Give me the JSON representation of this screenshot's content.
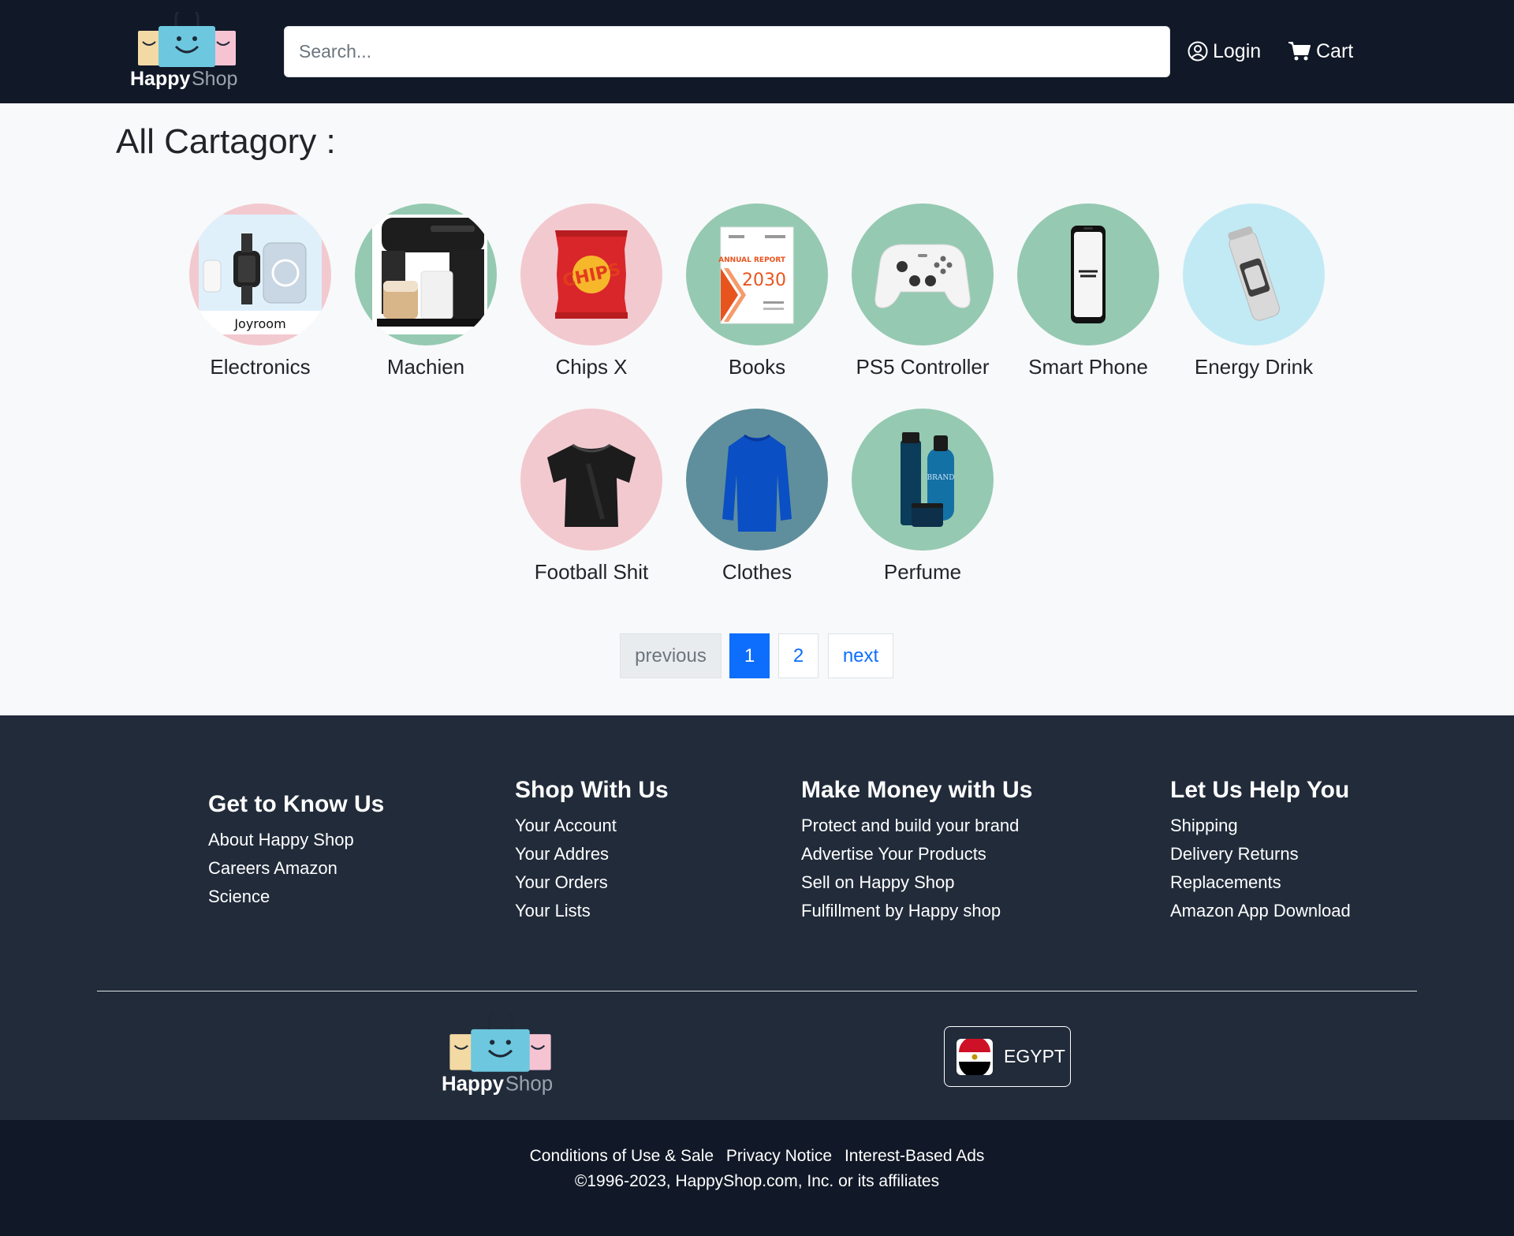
{
  "header": {
    "logo_text_happy": "Happy",
    "logo_text_shop": "Shop",
    "search_placeholder": "Search...",
    "login_label": "Login",
    "cart_label": "Cart"
  },
  "main": {
    "heading": "All Cartagory :",
    "categories": [
      {
        "label": "Electronics",
        "image_caption": "Joyroom"
      },
      {
        "label": "Machien"
      },
      {
        "label": "Chips X",
        "image_caption": "CHIPS"
      },
      {
        "label": "Books",
        "image_caption_1": "ANNUAL REPORT",
        "image_caption_2": "2030"
      },
      {
        "label": "PS5 Controller"
      },
      {
        "label": "Smart Phone"
      },
      {
        "label": "Energy Drink"
      },
      {
        "label": "Football Shit"
      },
      {
        "label": "Clothes"
      },
      {
        "label": "Perfume",
        "image_caption": "BRAND"
      }
    ],
    "pagination": {
      "previous": "previous",
      "pages": [
        "1",
        "2"
      ],
      "current": "1",
      "next": "next"
    }
  },
  "footer": {
    "columns": [
      {
        "title": "Get to Know Us",
        "links": [
          "About Happy Shop",
          "Careers Amazon",
          "Science"
        ]
      },
      {
        "title": "Shop With Us",
        "links": [
          "Your Account",
          "Your Addres",
          "Your Orders",
          "Your Lists"
        ]
      },
      {
        "title": "Make Money with Us",
        "links": [
          "Protect and build your brand",
          "Advertise Your Products",
          "Sell on Happy Shop",
          "Fulfillment by Happy shop"
        ]
      },
      {
        "title": "Let Us Help You",
        "links": [
          "Shipping",
          "Delivery Returns",
          "Replacements",
          "Amazon App Download"
        ]
      }
    ],
    "country": "EGYPT",
    "legal_links": [
      "Conditions of Use & Sale",
      "Privacy Notice",
      "Interest-Based Ads"
    ],
    "copyright": "©1996-2023, HappyShop.com, Inc. or its affiliates"
  },
  "colors": {
    "header_bg": "#111827",
    "footer_bg": "#212b3a",
    "accent": "#0d6efd",
    "circle_pink": "#f2c9cf",
    "circle_green": "#95c9b2",
    "circle_lightblue": "#c2eaf4",
    "circle_teal": "#5f8f9c"
  }
}
